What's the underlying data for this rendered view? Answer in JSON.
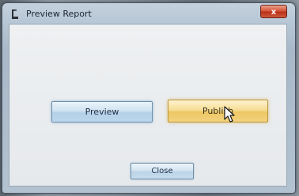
{
  "window": {
    "title": "Preview Report",
    "close_glyph": "x",
    "icon": "app-icon"
  },
  "buttons": {
    "preview_label": "Preview",
    "publish_label": "Publish",
    "close_label": "Close"
  },
  "colors": {
    "publish_hover": "#f6dd94",
    "button_blue": "#cfe3f1",
    "close_red": "#d5563b"
  },
  "cursor": {
    "icon": "pointer-cursor-icon"
  }
}
